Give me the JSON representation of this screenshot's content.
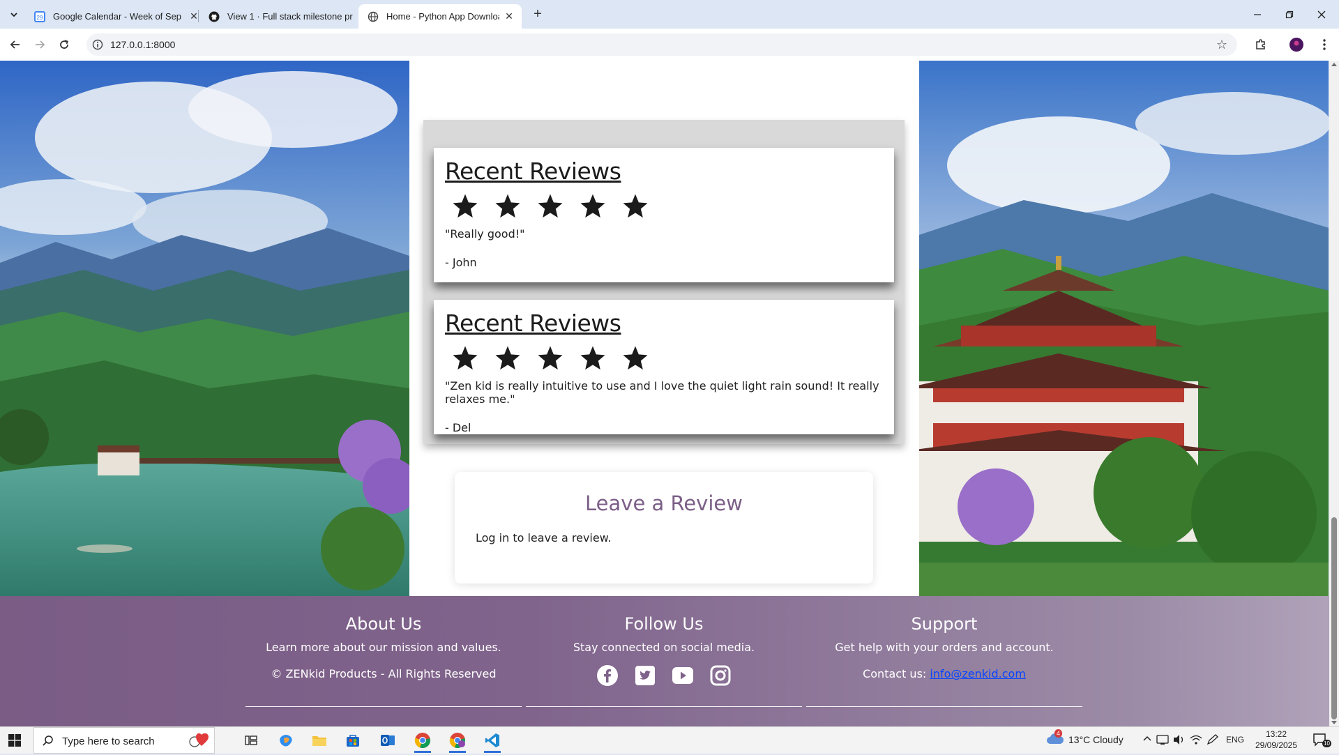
{
  "browser": {
    "tabs": [
      {
        "title": "Google Calendar - Week of Sep",
        "active": false
      },
      {
        "title": "View 1 · Full stack milestone pr",
        "active": false
      },
      {
        "title": "Home - Python App Download",
        "active": true
      }
    ],
    "url": "127.0.0.1:8000"
  },
  "reviews": [
    {
      "heading": "Recent Reviews",
      "stars": 5,
      "quote": "\"Really good!\"",
      "author": "- John"
    },
    {
      "heading": "Recent Reviews",
      "stars": 5,
      "quote": "\"Zen kid is really intuitive to use and I love the quiet light rain sound! It really relaxes me.\"",
      "author": "- Del"
    }
  ],
  "leave_review": {
    "title": "Leave a Review",
    "message": "Log in to leave a review."
  },
  "footer": {
    "about": {
      "title": "About Us",
      "text": "Learn more about our mission and values.",
      "copyright": "© ZENkid Products - All Rights Reserved"
    },
    "follow": {
      "title": "Follow Us",
      "text": "Stay connected on social media.",
      "icons": [
        "facebook-icon",
        "twitter-icon",
        "youtube-icon",
        "instagram-icon"
      ]
    },
    "support": {
      "title": "Support",
      "text": "Get help with your orders and account.",
      "contact_label": "Contact us:",
      "email": "info@zenkid.com"
    }
  },
  "taskbar": {
    "search_placeholder": "Type here to search",
    "weather": "13°C  Cloudy",
    "language": "ENG",
    "time": "13:22",
    "date": "29/09/2025",
    "notification_count": "10",
    "weather_badge": "4"
  },
  "colors": {
    "footer_purple": "#7a5c85",
    "heading_purple": "#7c5f87",
    "link_blue": "#0645ff",
    "panel_gray": "#d9d9d9"
  }
}
